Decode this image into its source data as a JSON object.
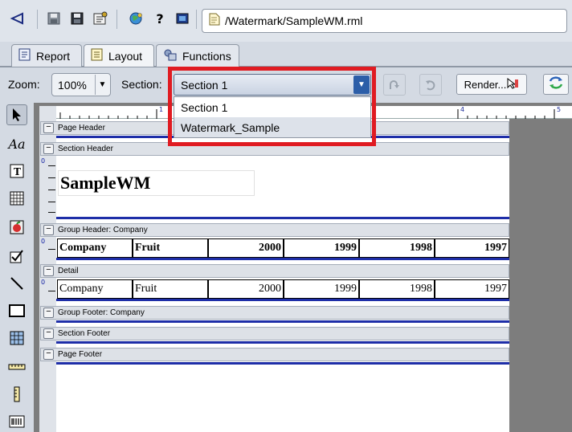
{
  "topbar": {
    "file_path": "/Watermark/SampleWM.rml",
    "icons": [
      "back-arrow-icon",
      "save-icon",
      "save-as-icon",
      "properties-icon",
      "globe-icon",
      "help-icon",
      "image-icon",
      "document-icon"
    ],
    "help_glyph": "?"
  },
  "tabs": [
    {
      "label": "Report",
      "icon": "report-icon",
      "active": false
    },
    {
      "label": "Layout",
      "icon": "layout-icon",
      "active": true
    },
    {
      "label": "Functions",
      "icon": "functions-icon",
      "active": false
    }
  ],
  "toolbar": {
    "zoom_label": "Zoom:",
    "zoom_value": "100%",
    "section_label": "Section:",
    "section_value": "Section 1",
    "render_label": "Render...",
    "dropdown_options": [
      "Section 1",
      "Watermark_Sample"
    ],
    "highlight_color": "#e01b22"
  },
  "ruler": {
    "marks": [
      "1",
      "4",
      "5"
    ]
  },
  "bands": {
    "page_header": "Page Header",
    "section_header": "Section Header",
    "group_header": "Group Header: Company",
    "detail": "Detail",
    "group_footer": "Group Footer: Company",
    "section_footer": "Section Footer",
    "page_footer": "Page Footer",
    "zero": "0",
    "collapse_glyph": "−"
  },
  "report": {
    "title": "SampleWM",
    "headers": [
      "Company",
      "Fruit",
      "2000",
      "1999",
      "1998",
      "1997"
    ],
    "detail": [
      "Company",
      "Fruit",
      "2000",
      "1999",
      "1998",
      "1997"
    ]
  },
  "palette": [
    "pointer-icon",
    "text-icon",
    "field-icon",
    "table-icon",
    "image-icon",
    "checkbox-icon",
    "line-icon",
    "rectangle-icon",
    "grid-icon",
    "horizontal-ruler-icon",
    "vertical-ruler-icon",
    "barcode-icon"
  ],
  "colors": {
    "band_line": "#1e2ea8",
    "canvas_bg": "#7d7d7d",
    "section_arrow": "#2c5ea8"
  }
}
